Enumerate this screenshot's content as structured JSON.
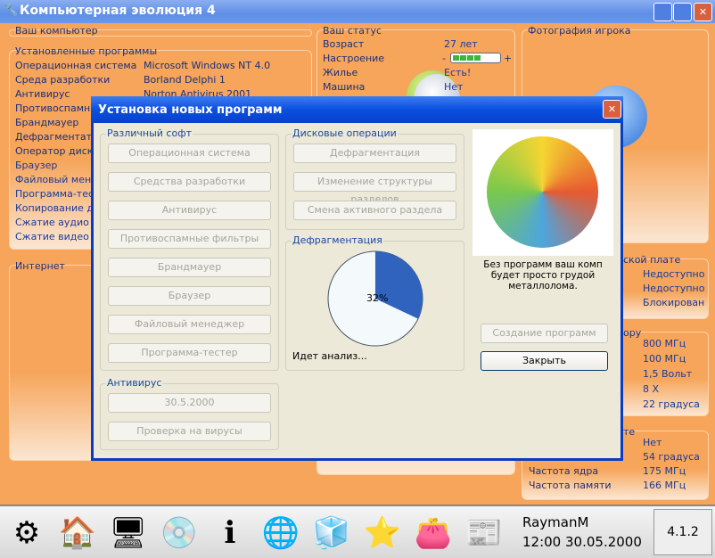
{
  "window": {
    "title": "Компьютерная эволюция 4"
  },
  "computer": {
    "title": "Ваш компьютер",
    "installed_title": "Установленные программы",
    "programs": [
      {
        "label": "Операционная система",
        "value": "Microsoft Windows NT 4.0"
      },
      {
        "label": "Среда разработки",
        "value": "Borland Delphi 1"
      },
      {
        "label": "Антивирус",
        "value": "Norton Antivirus 2001"
      },
      {
        "label": "Противоспамны",
        "value": ""
      },
      {
        "label": "Брандмауер",
        "value": ""
      },
      {
        "label": "Дефрагментатор",
        "value": ""
      },
      {
        "label": "Оператор диско",
        "value": ""
      },
      {
        "label": "Браузер",
        "value": ""
      },
      {
        "label": "Файловый мене",
        "value": ""
      },
      {
        "label": "Программа-тест",
        "value": ""
      },
      {
        "label": "Копирование д",
        "value": ""
      },
      {
        "label": "Сжатие аудио",
        "value": ""
      },
      {
        "label": "Сжатие видео",
        "value": ""
      }
    ],
    "internet_title": "Интернет"
  },
  "status": {
    "title": "Ваш статус",
    "rows": [
      {
        "label": "Возраст",
        "value": "27 лет"
      },
      {
        "label": "Настроение",
        "value": ""
      },
      {
        "label": "Жилье",
        "value": "Есть!"
      },
      {
        "label": "Машина",
        "value": "Нет"
      }
    ],
    "mood_minus": "-",
    "mood_plus": "+",
    "mood_level": 0.6
  },
  "photo": {
    "title": "Фотография игрока"
  },
  "motherboard": {
    "title": "ской плате",
    "values": [
      "Недоступно",
      "Недоступно",
      "Блокирован"
    ]
  },
  "cpu": {
    "title": "ору",
    "values": [
      "800 МГц",
      "100 МГц",
      "1,5 Вольт",
      "8 X",
      "22 градуса"
    ]
  },
  "video": {
    "title": "те",
    "rows": [
      {
        "label": "",
        "value": "Нет"
      },
      {
        "label": "",
        "value": "54 градуса"
      },
      {
        "label": "Частота ядра",
        "value": "175 МГц"
      },
      {
        "label": "Частота памяти",
        "value": "166 МГц"
      }
    ]
  },
  "dialog": {
    "title": "Установка новых программ",
    "soft_title": "Различный софт",
    "soft_buttons": [
      "Операционная система",
      "Средства разработки",
      "Антивирус",
      "Противоспамные фильтры",
      "Брандмауер",
      "Браузер",
      "Файловый менеджер",
      "Программа-тестер"
    ],
    "antivirus_title": "Антивирус",
    "antivirus_buttons": [
      "30.5.2000",
      "Проверка на вирусы"
    ],
    "disk_title": "Дисковые операции",
    "disk_buttons": [
      "Дефрагментация",
      "Изменение структуры разделов",
      "Смена активного раздела"
    ],
    "defrag_title": "Дефрагментация",
    "defrag_percent": 32,
    "defrag_label": "32%",
    "defrag_status": "Идет анализ...",
    "caption": "Без программ ваш комп будет просто грудой металлолома.",
    "create_button": "Создание программ",
    "close_button": "Закрыть",
    "colors": {
      "pie_fill": "#2f63bd",
      "pie_bg": "#f4f9fb"
    }
  },
  "taskbar": {
    "icons": [
      "kde-icon",
      "home-icon",
      "computer-icon",
      "install-icon",
      "info-board-icon",
      "globe-icon",
      "cubes-icon",
      "star-icon",
      "wallet-icon",
      "newspaper-icon"
    ],
    "user": "RaymanM",
    "datetime": "12:00 30.05.2000",
    "version": "4.1.2"
  }
}
